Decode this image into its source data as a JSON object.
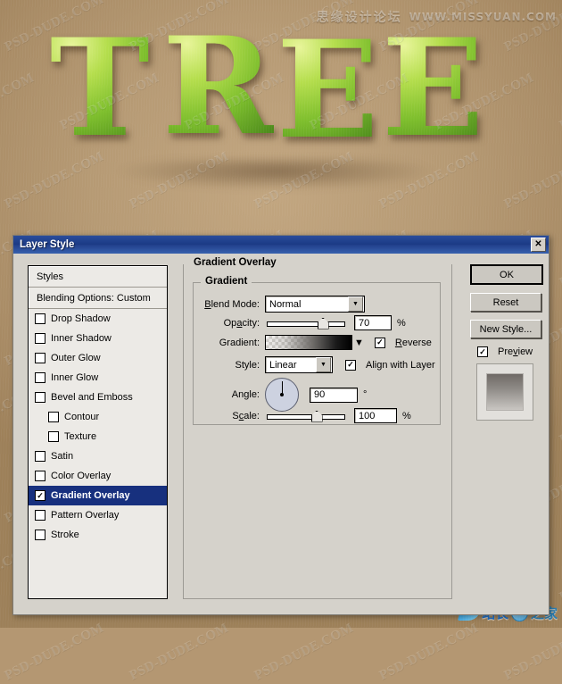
{
  "artwork": {
    "headline_letters": [
      "T",
      "R",
      "E",
      "E"
    ],
    "headline_text": "TREE",
    "background_color": "#b49772",
    "leaf_green": "#7dbe2c",
    "watermark_text": "PSD-DUDE.COM",
    "top_watermark": {
      "chinese": "思缘设计论坛",
      "url": "WWW.MISSYUAN.COM"
    },
    "logo": {
      "text": "站长",
      "suffix": "之家"
    }
  },
  "dialog": {
    "title": "Layer Style",
    "close_label": "✕",
    "styles_list": {
      "header_styles": "Styles",
      "header_blending": "Blending Options: Custom",
      "items": [
        {
          "label": "Drop Shadow",
          "checked": false,
          "indent": false,
          "selected": false
        },
        {
          "label": "Inner Shadow",
          "checked": false,
          "indent": false,
          "selected": false
        },
        {
          "label": "Outer Glow",
          "checked": false,
          "indent": false,
          "selected": false
        },
        {
          "label": "Inner Glow",
          "checked": false,
          "indent": false,
          "selected": false
        },
        {
          "label": "Bevel and Emboss",
          "checked": false,
          "indent": false,
          "selected": false
        },
        {
          "label": "Contour",
          "checked": false,
          "indent": true,
          "selected": false
        },
        {
          "label": "Texture",
          "checked": false,
          "indent": true,
          "selected": false
        },
        {
          "label": "Satin",
          "checked": false,
          "indent": false,
          "selected": false
        },
        {
          "label": "Color Overlay",
          "checked": false,
          "indent": false,
          "selected": false
        },
        {
          "label": "Gradient Overlay",
          "checked": true,
          "indent": false,
          "selected": true
        },
        {
          "label": "Pattern Overlay",
          "checked": false,
          "indent": false,
          "selected": false
        },
        {
          "label": "Stroke",
          "checked": false,
          "indent": false,
          "selected": false
        }
      ]
    },
    "panel": {
      "title": "Gradient Overlay",
      "group_title": "Gradient",
      "blend_mode": {
        "label": "Blend Mode:",
        "value": "Normal"
      },
      "opacity": {
        "label": "Opacity:",
        "value": "70",
        "unit": "%",
        "percent": 70
      },
      "gradient": {
        "label": "Gradient:",
        "reverse_label": "Reverse",
        "reverse_checked": true
      },
      "style": {
        "label": "Style:",
        "value": "Linear",
        "align_label": "Align with Layer",
        "align_checked": true
      },
      "angle": {
        "label": "Angle:",
        "value": "90",
        "unit": "°"
      },
      "scale": {
        "label": "Scale:",
        "value": "100",
        "unit": "%",
        "percent": 62
      }
    },
    "buttons": {
      "ok": "OK",
      "reset": "Reset",
      "new_style": "New Style...",
      "preview_label": "Preview",
      "preview_checked": true
    }
  }
}
